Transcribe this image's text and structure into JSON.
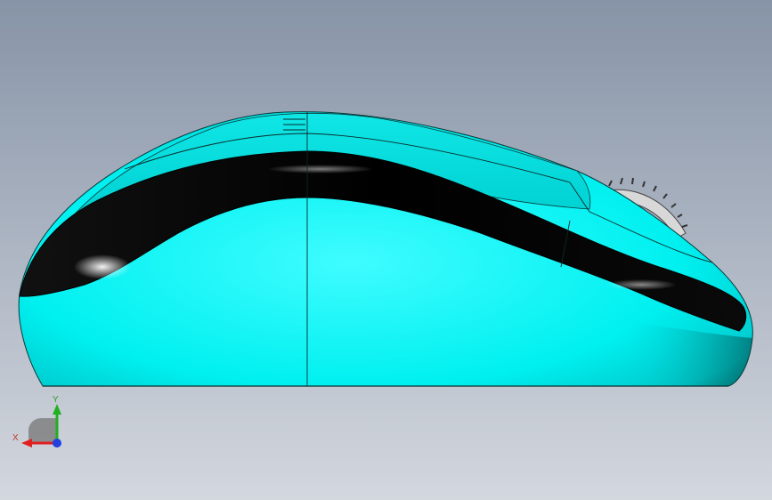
{
  "viewport": {
    "background_top": "#8794a7",
    "background_bottom": "#d3d7de"
  },
  "model": {
    "name": "mouse",
    "view": "side",
    "body_color": "#00e8e8",
    "band_color": "#000000",
    "wheel_color": "#d8d8d8"
  },
  "triad": {
    "x_label": "X",
    "y_label": "Y",
    "x_color": "#e02020",
    "y_color": "#20b020",
    "z_color": "#2040e0"
  }
}
